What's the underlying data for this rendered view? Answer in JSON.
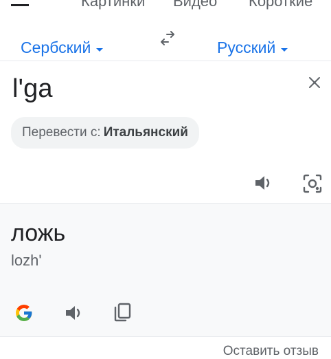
{
  "tabs": {
    "images": "Картинки",
    "videos": "Видео",
    "shorts": "Короткие"
  },
  "languages": {
    "source": "Сербский",
    "target": "Русский"
  },
  "source": {
    "text": "l'ga",
    "detect_prefix": "Перевести с:",
    "detect_language": "Итальянский"
  },
  "result": {
    "text": "ложь",
    "transliteration": "lozh'"
  },
  "footer": {
    "feedback": "Оставить отзыв"
  },
  "icons": [
    "swap-languages-icon",
    "close-icon",
    "speaker-icon",
    "camera-icon",
    "google-logo-icon",
    "copy-icon"
  ],
  "colors": {
    "accent": "#1a73e8",
    "result_bg": "#f8f9fa",
    "chip_bg": "#f1f3f4"
  }
}
